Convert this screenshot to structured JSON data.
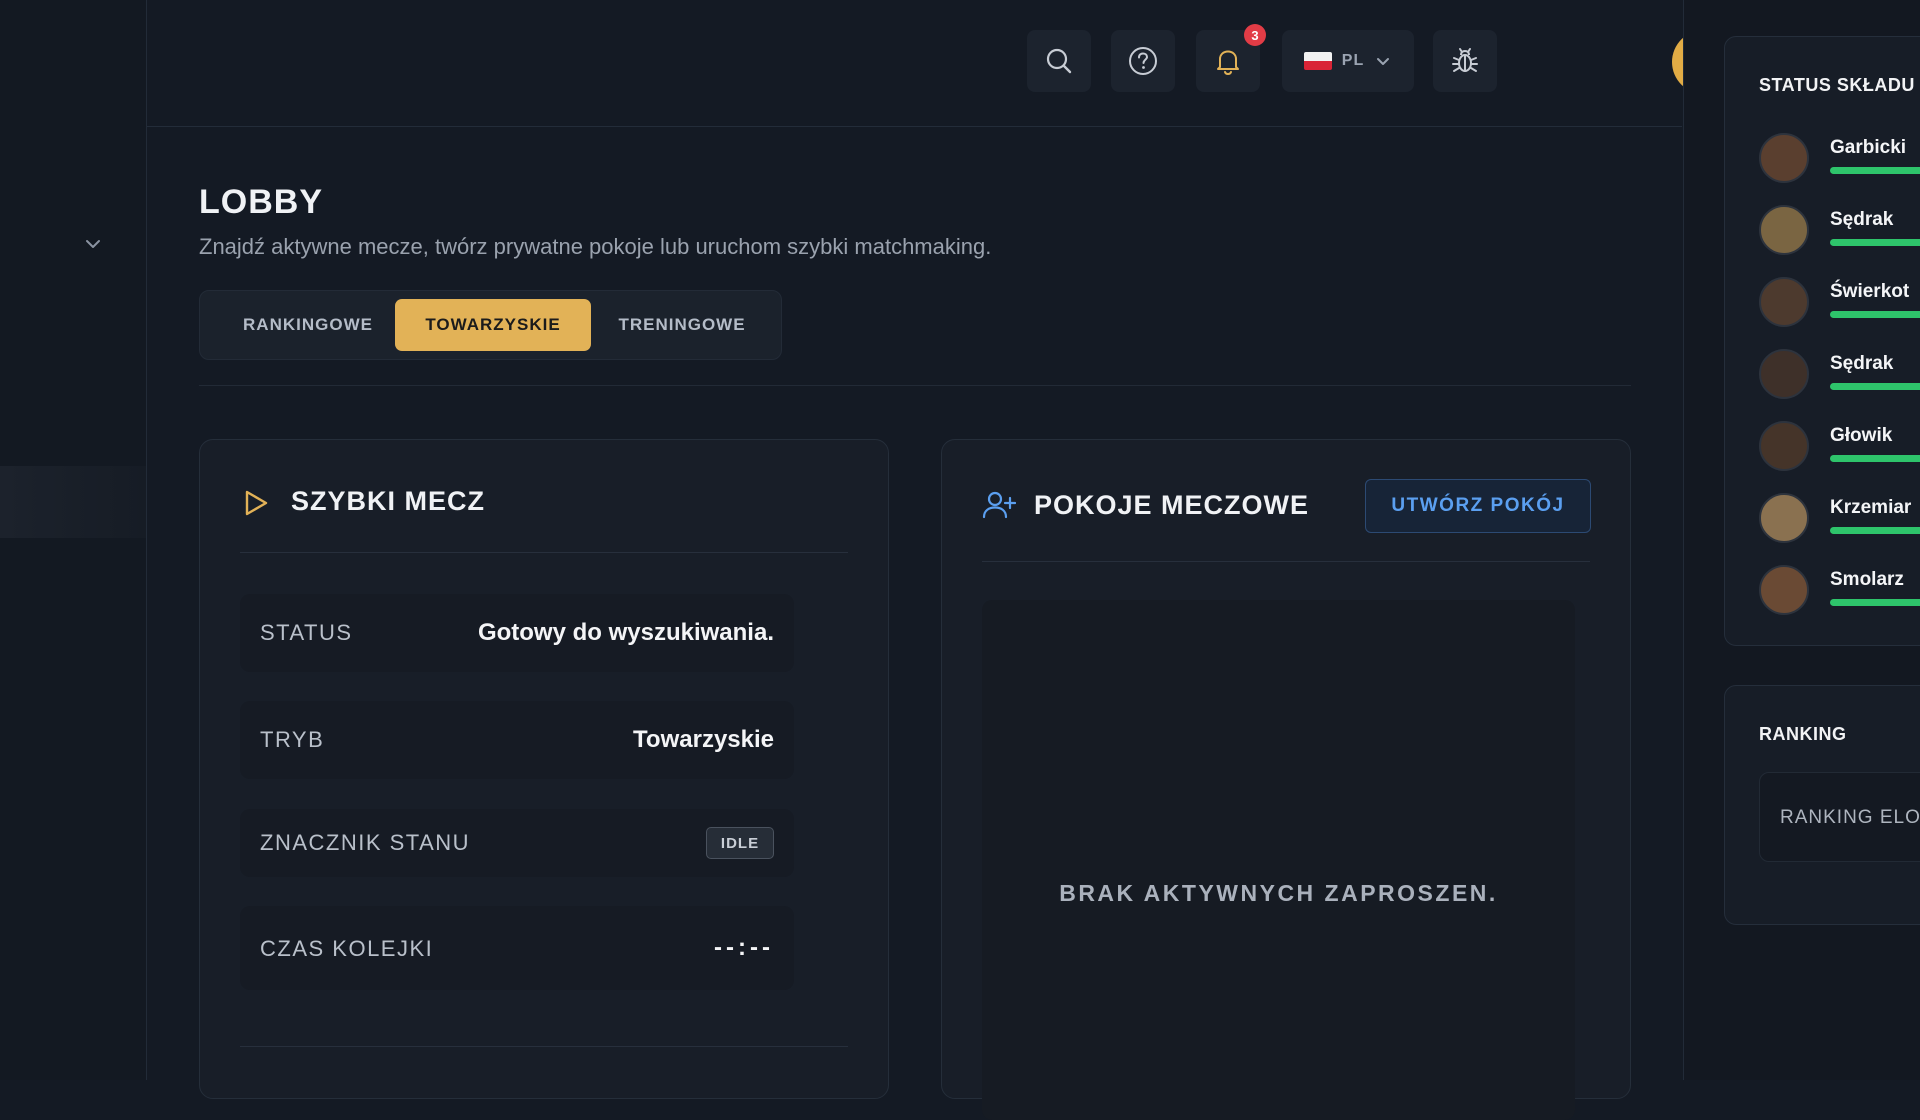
{
  "header": {
    "notifications_count": "3",
    "language": "PL",
    "icons": [
      "search-icon",
      "help-icon",
      "bell-icon",
      "poland-flag-icon",
      "chevron-down-icon",
      "bug-icon",
      "user-icon"
    ]
  },
  "lobby": {
    "title": "LOBBY",
    "subtitle": "Znajdź aktywne mecze, twórz prywatne pokoje lub uruchom szybki matchmaking.",
    "tabs": [
      {
        "label": "RANKINGOWE",
        "active": false
      },
      {
        "label": "TOWARZYSKIE",
        "active": true
      },
      {
        "label": "TRENINGOWE",
        "active": false
      }
    ]
  },
  "quick_match": {
    "title": "SZYBKI MECZ",
    "rows": {
      "status": {
        "label": "STATUS",
        "value": "Gotowy do wyszukiwania."
      },
      "mode": {
        "label": "TRYB",
        "value": "Towarzyskie"
      },
      "state": {
        "label": "ZNACZNIK STANU",
        "badge": "IDLE"
      },
      "queue": {
        "label": "CZAS KOLEJKI",
        "value": "--:--"
      }
    }
  },
  "match_rooms": {
    "title": "POKOJE MECZOWE",
    "create_button": "UTWÓRZ POKÓJ",
    "empty_text": "BRAK AKTYWNYCH ZAPROSZEN."
  },
  "squad": {
    "title": "STATUS SKŁADU",
    "players": [
      {
        "name": "Garbicki"
      },
      {
        "name": "Sędrak"
      },
      {
        "name": "Świerkot"
      },
      {
        "name": "Sędrak"
      },
      {
        "name": "Głowik"
      },
      {
        "name": "Krzemiar"
      },
      {
        "name": "Smolarz"
      }
    ],
    "status_color": "#2ec46b"
  },
  "ranking": {
    "title": "RANKING",
    "elo_label": "RANKING ELO"
  },
  "colors": {
    "accent": "#e2b257",
    "background": "#141a24",
    "link_blue": "#5b9ff0",
    "badge_red": "#e23c46"
  }
}
